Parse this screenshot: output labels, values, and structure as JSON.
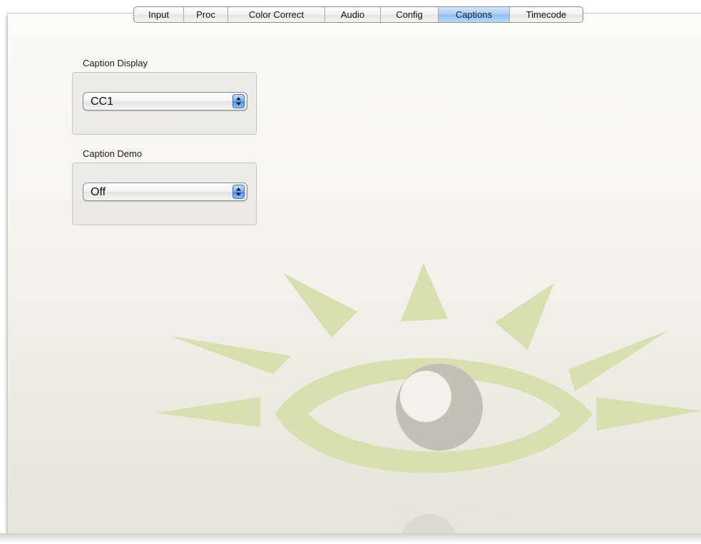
{
  "tabs": [
    {
      "label": "Input",
      "selected": false
    },
    {
      "label": "Proc",
      "selected": false
    },
    {
      "label": "Color Correct",
      "selected": false
    },
    {
      "label": "Audio",
      "selected": false
    },
    {
      "label": "Config",
      "selected": false
    },
    {
      "label": "Captions",
      "selected": true
    },
    {
      "label": "Timecode",
      "selected": false
    }
  ],
  "caption_display": {
    "label": "Caption Display",
    "value": "CC1"
  },
  "caption_demo": {
    "label": "Caption Demo",
    "value": "Off"
  },
  "watermark": {
    "icon": "eye-icon",
    "ray_color": "#d8dfb1",
    "iris_color": "#c2c0b5"
  }
}
